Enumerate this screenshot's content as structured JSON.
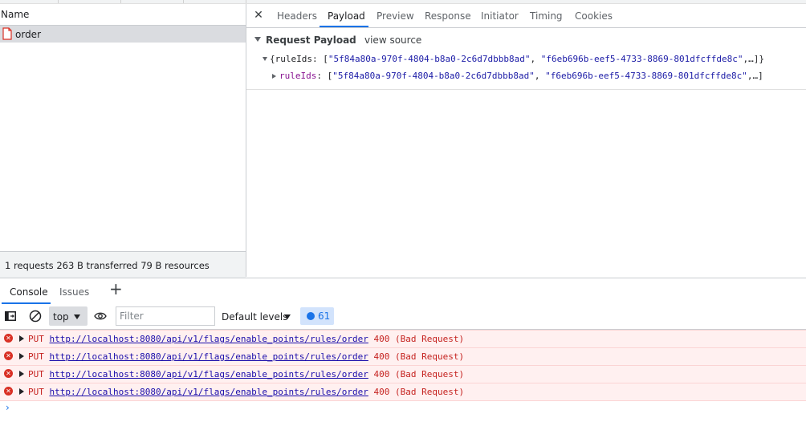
{
  "request_list": {
    "column_header": "Name",
    "requests": [
      {
        "name": "order"
      }
    ],
    "summary": "1 requests  263 B transferred  79 B resources"
  },
  "details": {
    "close_icon": "close-icon",
    "tabs": [
      "Headers",
      "Payload",
      "Preview",
      "Response",
      "Initiator",
      "Timing",
      "Cookies"
    ],
    "active_tab": "Payload",
    "payload": {
      "title": "Request Payload",
      "view_source": "view source",
      "line1_open": "{",
      "line1_key": "ruleIds",
      "line1_sep": ": [",
      "line1_val1": "\"5f84a80a-970f-4804-b8a0-2c6d7dbbb8ad\"",
      "line1_comma": ", ",
      "line1_val2": "\"f6eb696b-eef5-4733-8869-801dfcffde8c\"",
      "line1_close": ",…]}",
      "line2_key": "ruleIds",
      "line2_sep": ": [",
      "line2_val1": "\"5f84a80a-970f-4804-b8a0-2c6d7dbbb8ad\"",
      "line2_comma": ", ",
      "line2_val2": "\"f6eb696b-eef5-4733-8869-801dfcffde8c\"",
      "line2_close": ",…]"
    }
  },
  "drawer": {
    "tabs": [
      "Console",
      "Issues"
    ],
    "active_tab": "Console",
    "add_icon": "plus-icon"
  },
  "console_toolbar": {
    "context": "top",
    "filter_placeholder": "Filter",
    "levels": "Default levels",
    "message_count": "61"
  },
  "logs": [
    {
      "method": "PUT",
      "url": "http://localhost:8080/api/v1/flags/enable_points/rules/order",
      "status": "400 (Bad Request)"
    },
    {
      "method": "PUT",
      "url": "http://localhost:8080/api/v1/flags/enable_points/rules/order",
      "status": "400 (Bad Request)"
    },
    {
      "method": "PUT",
      "url": "http://localhost:8080/api/v1/flags/enable_points/rules/order",
      "status": "400 (Bad Request)"
    },
    {
      "method": "PUT",
      "url": "http://localhost:8080/api/v1/flags/enable_points/rules/order",
      "status": "400 (Bad Request)"
    }
  ],
  "prompt": "›",
  "colors": {
    "accent": "#1a73e8",
    "error": "#d93025",
    "error_bg": "#fff0f0"
  }
}
